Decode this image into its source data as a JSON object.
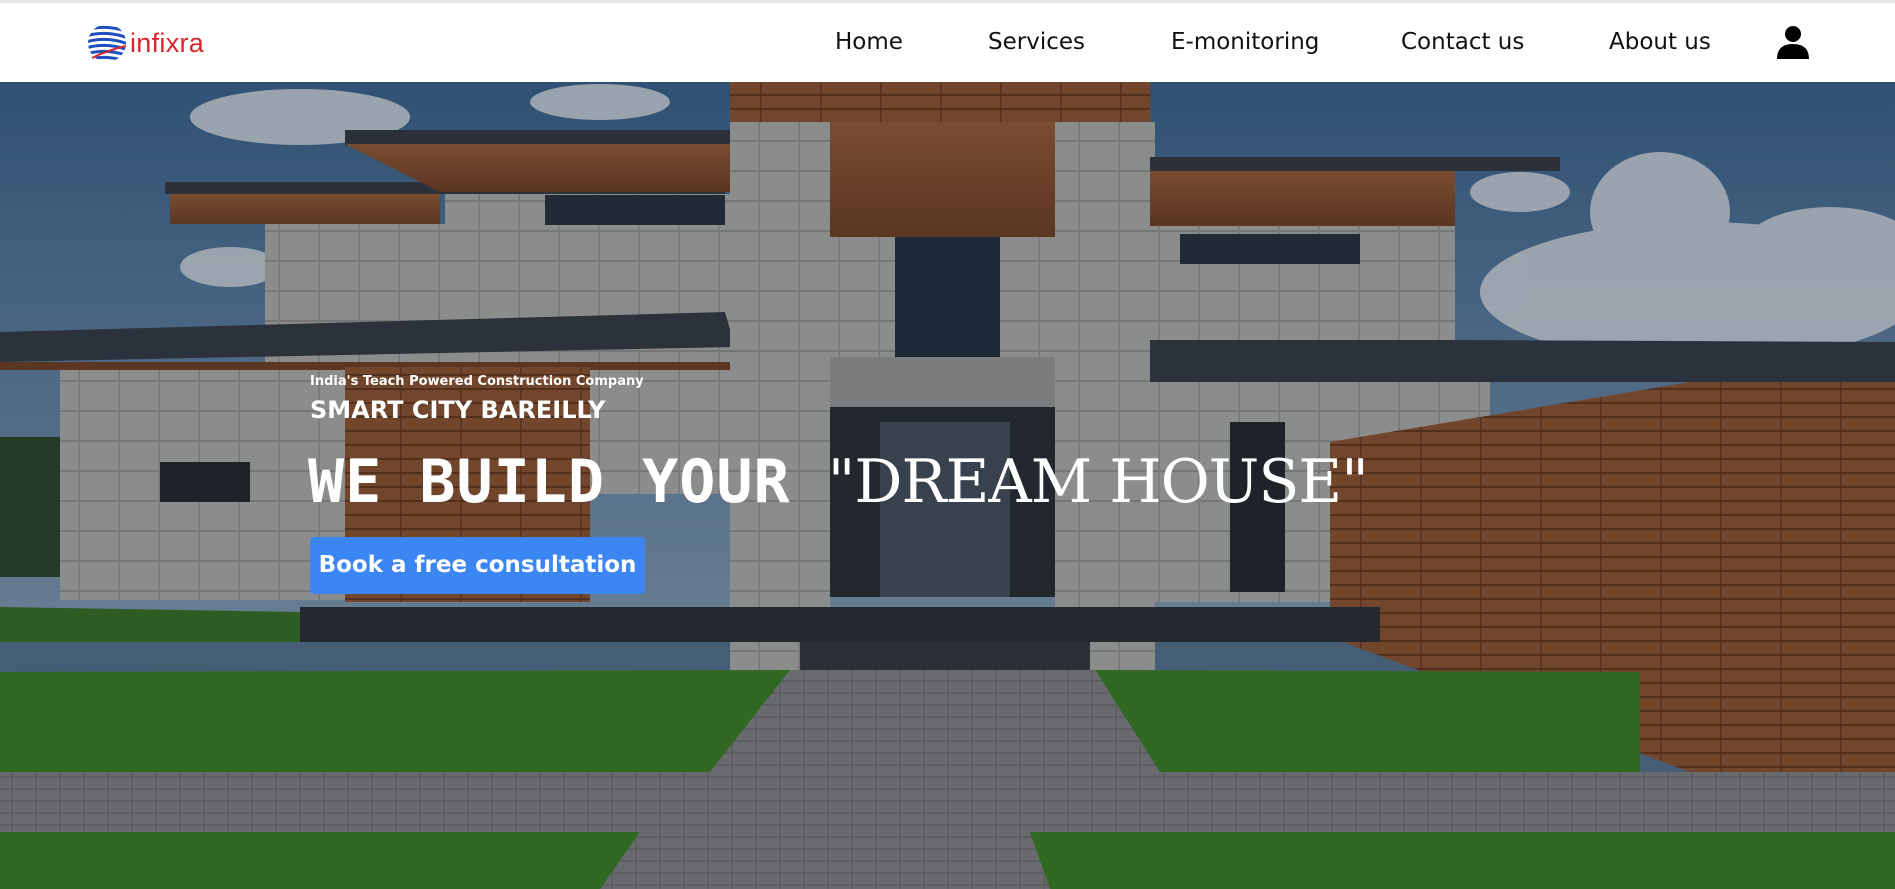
{
  "brand": {
    "name": "infixra",
    "logo_icon": "globe-stripes-icon",
    "color": "#d7262e"
  },
  "nav": {
    "items": [
      {
        "label": "Home"
      },
      {
        "label": "Services"
      },
      {
        "label": "E-monitoring"
      },
      {
        "label": "Contact us"
      },
      {
        "label": "About us"
      }
    ],
    "user_icon": "user-icon"
  },
  "hero": {
    "tagline": "India's Teach Powered Construction Company",
    "subtitle": "SMART CITY BAREILLY",
    "headline_part1": "WE BUILD YOUR ",
    "headline_part2": "\"DREAM HOUSE\"",
    "cta_label": "Book a free consultation",
    "cta_color": "#3b86f2",
    "background_image": "modern-house-photo"
  }
}
